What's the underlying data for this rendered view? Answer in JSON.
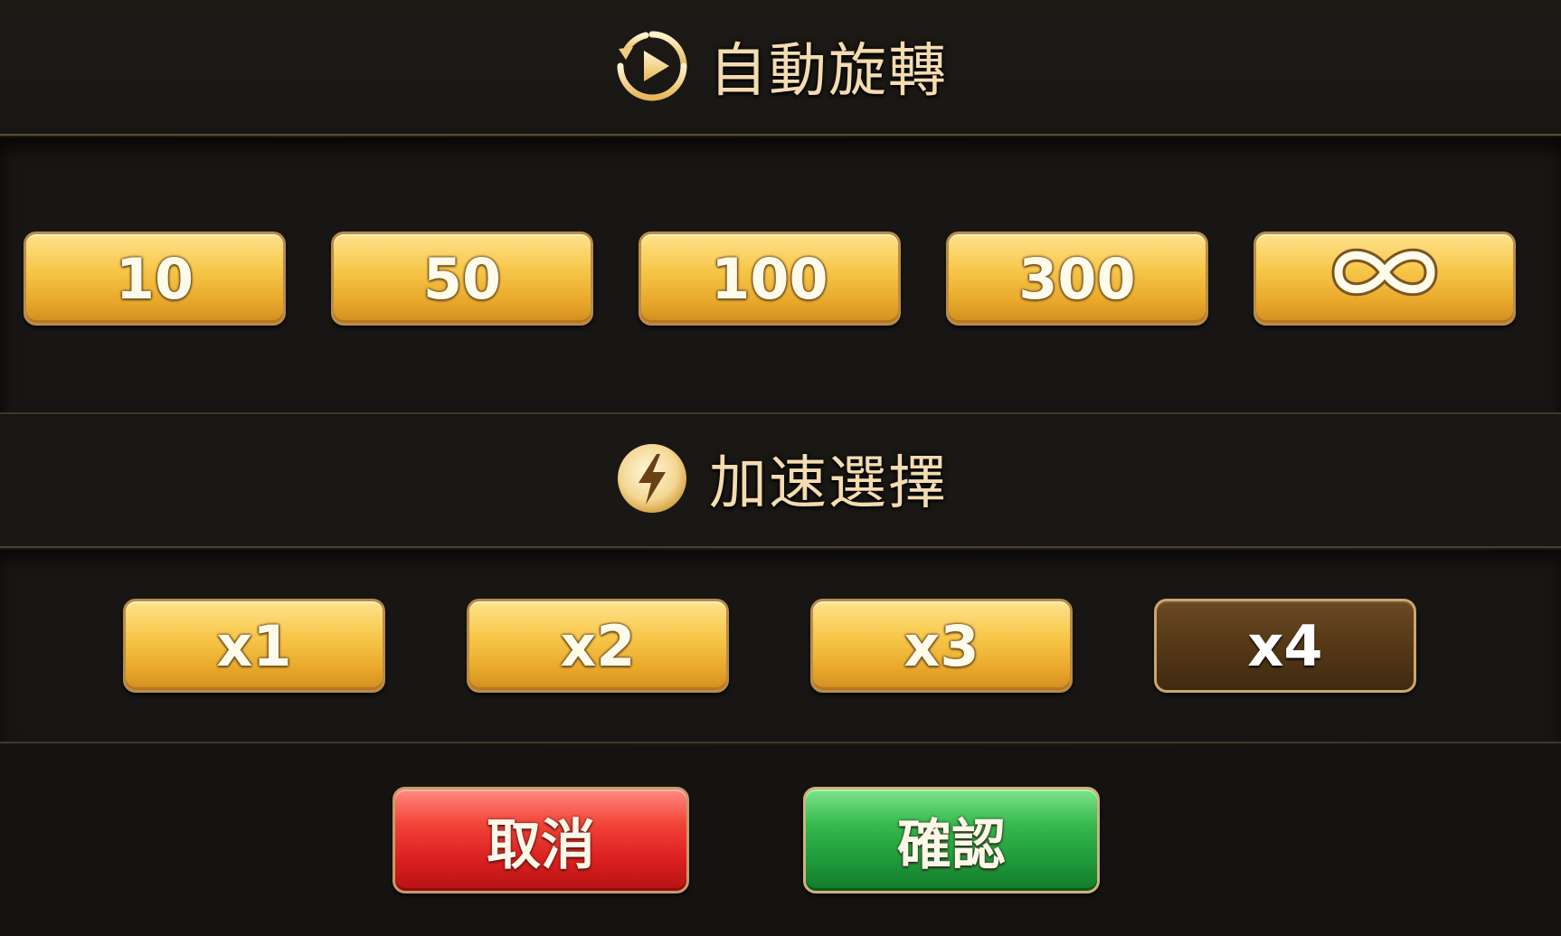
{
  "auto_spin": {
    "title": "自動旋轉",
    "icon": "play-circle-icon",
    "options": [
      {
        "label": "10"
      },
      {
        "label": "50"
      },
      {
        "label": "100"
      },
      {
        "label": "300"
      },
      {
        "label": "",
        "icon": "infinity-icon"
      }
    ]
  },
  "speed": {
    "title": "加速選擇",
    "icon": "lightning-icon",
    "options": [
      {
        "label": "x1",
        "selected": false
      },
      {
        "label": "x2",
        "selected": false
      },
      {
        "label": "x3",
        "selected": false
      },
      {
        "label": "x4",
        "selected": true
      }
    ]
  },
  "actions": {
    "cancel_label": "取消",
    "confirm_label": "確認"
  },
  "colors": {
    "gold": "#f7c74a",
    "selected": "#553816",
    "cancel": "#db1f1f",
    "confirm": "#1f9a3b",
    "title_text": "#f4dcb0"
  }
}
